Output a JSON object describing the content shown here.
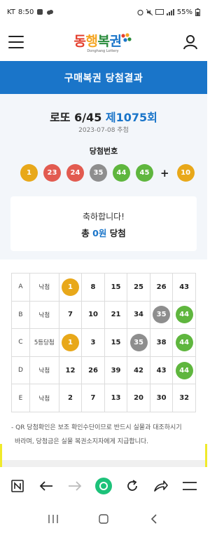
{
  "status_bar": {
    "carrier": "KT",
    "time": "8:50",
    "battery": "55%"
  },
  "header": {
    "logo_text": "동행복권",
    "logo_sub": "Donghang Lottery",
    "logo_colors": [
      "#e4402f",
      "#f5a623",
      "#2a8c3c",
      "#1a75c9"
    ]
  },
  "banner": {
    "title": "구매복권 당첨결과"
  },
  "draw": {
    "game_name": "로또 6/45",
    "round": "제1075회",
    "date": "2023-07-08 추첨",
    "winning_label": "당첨번호",
    "numbers": [
      {
        "n": "1",
        "color": "#e8a81a"
      },
      {
        "n": "23",
        "color": "#e25b50"
      },
      {
        "n": "24",
        "color": "#e25b50"
      },
      {
        "n": "35",
        "color": "#8e8e8e"
      },
      {
        "n": "44",
        "color": "#5fb63e"
      },
      {
        "n": "45",
        "color": "#5fb63e"
      }
    ],
    "plus": "+",
    "bonus": {
      "n": "10",
      "color": "#e8a81a"
    }
  },
  "result_card": {
    "message": "축하합니다!",
    "prize_prefix": "총",
    "prize_amount": "0원",
    "prize_suffix": "당첨"
  },
  "games": [
    {
      "id": "A",
      "result": "낙첨",
      "nums": [
        {
          "n": "1",
          "ball": "#e8a81a"
        },
        {
          "n": "8"
        },
        {
          "n": "15"
        },
        {
          "n": "25"
        },
        {
          "n": "26"
        },
        {
          "n": "43"
        }
      ]
    },
    {
      "id": "B",
      "result": "낙첨",
      "nums": [
        {
          "n": "7"
        },
        {
          "n": "10"
        },
        {
          "n": "21"
        },
        {
          "n": "34"
        },
        {
          "n": "35",
          "ball": "#8e8e8e"
        },
        {
          "n": "44",
          "ball": "#5fb63e"
        }
      ]
    },
    {
      "id": "C",
      "result": "5등당첨",
      "nums": [
        {
          "n": "1",
          "ball": "#e8a81a"
        },
        {
          "n": "3"
        },
        {
          "n": "15"
        },
        {
          "n": "35",
          "ball": "#8e8e8e"
        },
        {
          "n": "38"
        },
        {
          "n": "44",
          "ball": "#5fb63e"
        }
      ]
    },
    {
      "id": "D",
      "result": "낙첨",
      "nums": [
        {
          "n": "12"
        },
        {
          "n": "26"
        },
        {
          "n": "39"
        },
        {
          "n": "42"
        },
        {
          "n": "43"
        },
        {
          "n": "44",
          "ball": "#5fb63e"
        }
      ]
    },
    {
      "id": "E",
      "result": "낙첨",
      "nums": [
        {
          "n": "2"
        },
        {
          "n": "7"
        },
        {
          "n": "13"
        },
        {
          "n": "20"
        },
        {
          "n": "30"
        },
        {
          "n": "32"
        }
      ]
    }
  ],
  "notice": {
    "line1": "- QR 당첨확인은 보조 확인수단이므로 반드시 실물과 대조하시기",
    "line2": "바라며, 당첨금은 실물 복권소지자에게 지급합니다."
  },
  "browser_toolbar": {
    "icons": [
      "n-badge-icon",
      "back-arrow-icon",
      "forward-arrow-icon",
      "home-circle-icon",
      "refresh-icon",
      "share-icon",
      "menu-icon"
    ],
    "accent": "#1dc27a"
  },
  "system_nav": {
    "icons": [
      "recents-icon",
      "home-icon",
      "back-icon"
    ]
  }
}
